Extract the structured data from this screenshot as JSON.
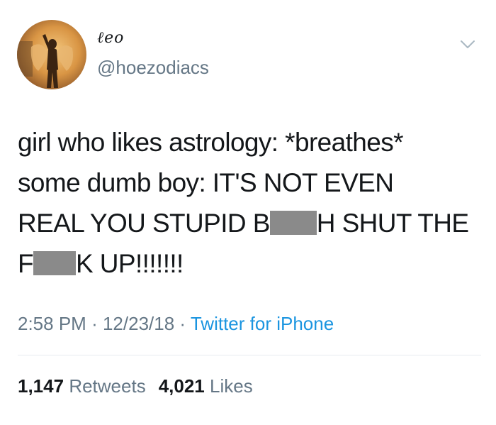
{
  "author": {
    "display_name": "ℓeo",
    "handle": "@hoezodiacs",
    "avatar_icon": "avatar-photo"
  },
  "tweet": {
    "lines": [
      {
        "parts": [
          "girl who likes astrology: *breathes*"
        ]
      },
      {
        "parts": [
          "some dumb boy: IT'S NOT EVEN"
        ]
      },
      {
        "parts": [
          "REAL YOU STUPID B",
          "H SHUT THE"
        ]
      },
      {
        "parts": [
          "F",
          "K UP!!!!!!!"
        ]
      }
    ]
  },
  "meta": {
    "time": "2:58 PM",
    "separator": "·",
    "date": "12/23/18",
    "source": "Twitter for iPhone"
  },
  "stats": {
    "retweets_count": "1,147",
    "retweets_label": "Retweets",
    "likes_count": "4,021",
    "likes_label": "Likes"
  },
  "colors": {
    "text": "#14171a",
    "secondary": "#657786",
    "link": "#1b95e0",
    "censor": "#8a8a8a"
  }
}
